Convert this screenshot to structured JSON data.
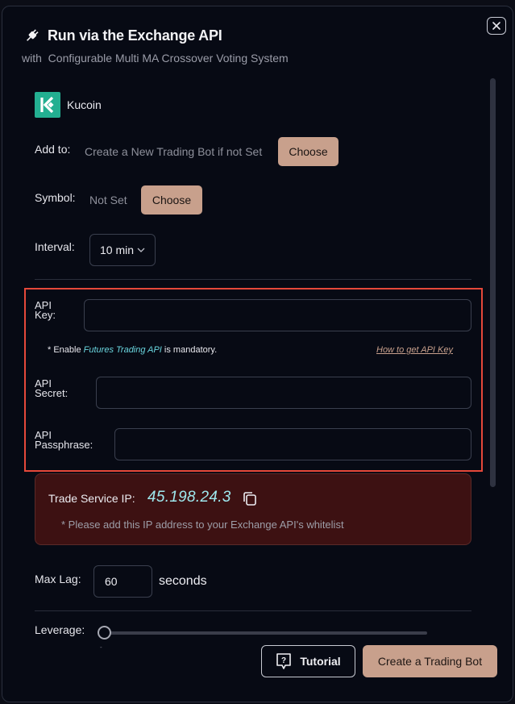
{
  "header": {
    "title": "Run via the Exchange API",
    "subtitle": "with  Configurable Multi MA Crossover Voting System",
    "icon": "plug-icon"
  },
  "exchange": {
    "name": "Kucoin",
    "brand_color": "#23AF91"
  },
  "add_to": {
    "label": "Add to:",
    "value": "Create a New Trading Bot if not Set",
    "button": "Choose"
  },
  "symbol": {
    "label": "Symbol:",
    "value": "Not Set",
    "button": "Choose"
  },
  "interval": {
    "label": "Interval:",
    "value": "10 min"
  },
  "api": {
    "key": {
      "label_line1": "API",
      "label_line2": "Key:",
      "value": ""
    },
    "note_prefix": "* Enable ",
    "note_emphasis": "Futures Trading API",
    "note_suffix": " is mandatory.",
    "help_link": "How to get API Key",
    "secret": {
      "label_line1": "API",
      "label_line2": "Secret:",
      "value": ""
    },
    "passphrase": {
      "label_line1": "API",
      "label_line2": "Passphrase:",
      "value": ""
    }
  },
  "trade_service": {
    "label": "Trade Service IP:",
    "ip": "45.198.24.3",
    "note": "* Please add this IP address to your Exchange API's whitelist"
  },
  "max_lag": {
    "label": "Max Lag:",
    "value": "60",
    "unit": "seconds"
  },
  "leverage": {
    "label": "Leverage:",
    "level": 0,
    "tick": "-"
  },
  "footer": {
    "tutorial": "Tutorial",
    "create": "Create a Trading Bot"
  },
  "colors": {
    "accent": "#C8A08C",
    "highlight_border": "#E5483A",
    "ip_text": "#9EE8EE",
    "panel_bg": "#3D1112"
  }
}
